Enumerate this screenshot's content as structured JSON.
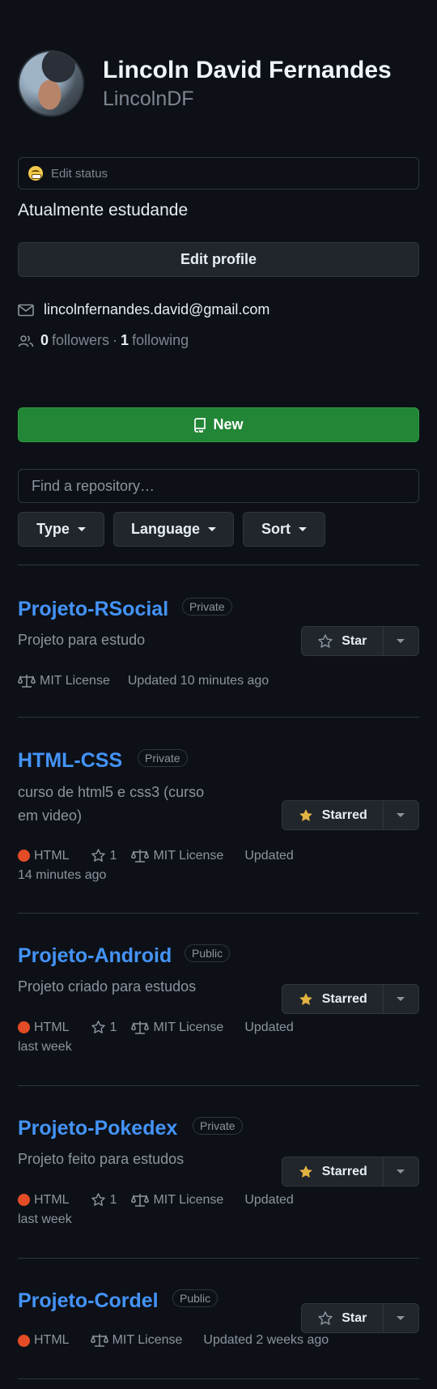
{
  "profile": {
    "name": "Lincoln David Fernandes",
    "login": "LincolnDF",
    "status_label": "Edit status",
    "bio": "Atualmente estudande",
    "edit_profile": "Edit profile",
    "email": "lincolnfernandes.david@gmail.com",
    "followers_count": "0",
    "followers_label": "followers",
    "separator": "·",
    "following_count": "1",
    "following_label": "following"
  },
  "repo_toolbar": {
    "new_label": "New",
    "search_placeholder": "Find a repository…",
    "filters": [
      "Type",
      "Language",
      "Sort"
    ]
  },
  "repos": [
    {
      "name": "Projeto-RSocial",
      "visibility": "Private",
      "description": "Projeto para estudo",
      "star_label": "Star",
      "starred": false,
      "license": "MIT License",
      "updated": "Updated 10 minutes ago"
    },
    {
      "name": "HTML-CSS",
      "visibility": "Private",
      "description_lines": [
        "curso de html5 e css3 (curso",
        "em video)"
      ],
      "star_label": "Starred",
      "starred": true,
      "language": "HTML",
      "stars": "1",
      "license": "MIT License",
      "updated_label": "Updated",
      "updated_when": "14 minutes ago"
    },
    {
      "name": "Projeto-Android",
      "visibility": "Public",
      "description": "Projeto criado para estudos",
      "star_label": "Starred",
      "starred": true,
      "language": "HTML",
      "stars": "1",
      "license": "MIT License",
      "updated_label": "Updated",
      "updated_when": "last week"
    },
    {
      "name": "Projeto-Pokedex",
      "visibility": "Private",
      "description": "Projeto feito para estudos",
      "star_label": "Starred",
      "starred": true,
      "language": "HTML",
      "stars": "1",
      "license": "MIT License",
      "updated_label": "Updated",
      "updated_when": "last week"
    },
    {
      "name": "Projeto-Cordel",
      "visibility": "Public",
      "star_label": "Star",
      "starred": false,
      "language": "HTML",
      "license": "MIT License",
      "updated": "Updated 2 weeks ago"
    }
  ],
  "colors": {
    "background": "#0d1117",
    "link": "#4493f8",
    "new_button": "#238636",
    "html_language": "#e34c26",
    "starred_icon": "#e3b341",
    "muted_text": "#8b949e",
    "border": "#30363d"
  },
  "icons": {
    "status": "grinning-face-emoji",
    "email": "mail-icon",
    "followers": "people-icon",
    "new": "repo-icon",
    "star": "star-icon",
    "starred": "star-fill-icon",
    "license": "law-scale-icon",
    "dropdown": "triangle-down-icon"
  }
}
